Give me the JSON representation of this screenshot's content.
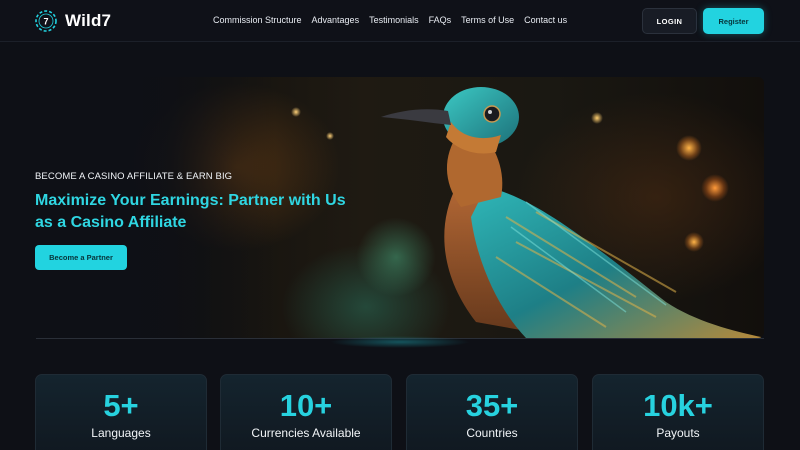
{
  "brand": {
    "name": "Wild7",
    "logo_digit": "7",
    "accent": "#22d3e0"
  },
  "nav": {
    "items": [
      {
        "label": "Commission Structure"
      },
      {
        "label": "Advantages"
      },
      {
        "label": "Testimonials"
      },
      {
        "label": "FAQs"
      },
      {
        "label": "Terms of Use"
      },
      {
        "label": "Contact us"
      }
    ],
    "login_label": "LOGIN",
    "register_label": "Register"
  },
  "hero": {
    "eyebrow": "BECOME A CASINO AFFILIATE & EARN BIG",
    "headline_line1": "Maximize Your Earnings: Partner with Us",
    "headline_line2": "as a Casino Affiliate",
    "cta_label": "Become a Partner",
    "image_subject": "iridescent-bird"
  },
  "stats": [
    {
      "value": "5+",
      "label": "Languages"
    },
    {
      "value": "10+",
      "label": "Currencies Available"
    },
    {
      "value": "35+",
      "label": "Countries"
    },
    {
      "value": "10k+",
      "label": "Payouts"
    }
  ]
}
